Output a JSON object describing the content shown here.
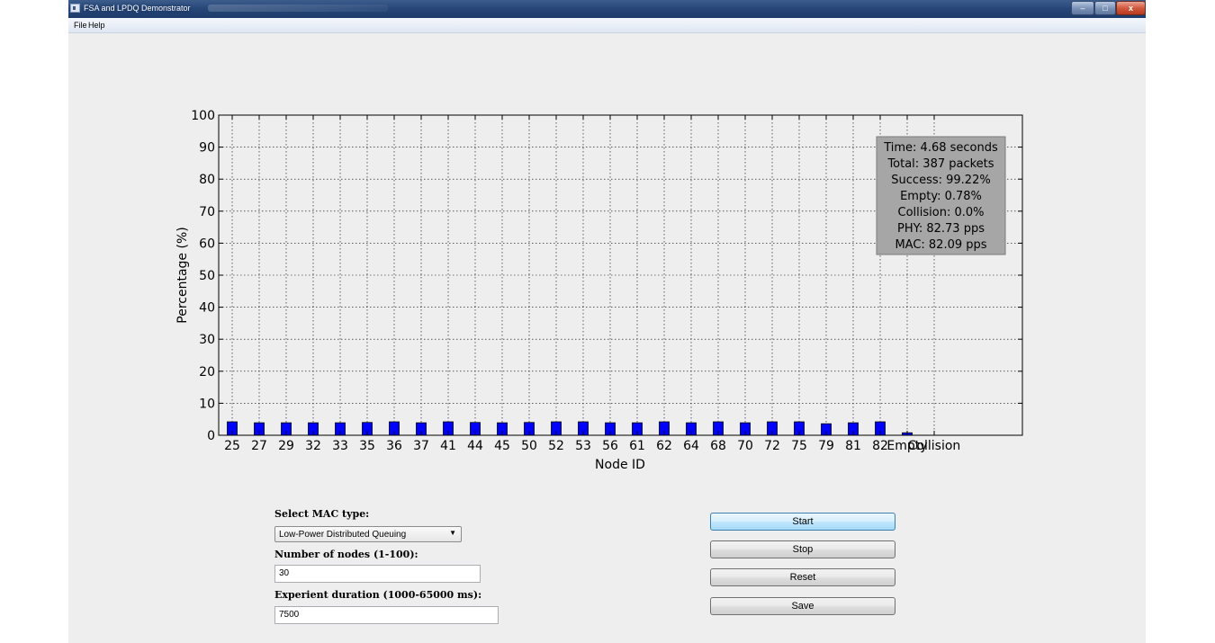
{
  "window": {
    "title": "FSA and LPDQ Demonstrator"
  },
  "controls": {
    "minimize": "–",
    "maximize": "□",
    "close": "x"
  },
  "menu": [
    "File",
    "Help"
  ],
  "chart_data": {
    "type": "bar",
    "xlabel": "Node ID",
    "ylabel": "Percentage (%)",
    "ylim": [
      0,
      100
    ],
    "yticks": [
      0,
      10,
      20,
      30,
      40,
      50,
      60,
      70,
      80,
      90,
      100
    ],
    "categories": [
      "25",
      "27",
      "29",
      "32",
      "33",
      "35",
      "36",
      "37",
      "41",
      "44",
      "45",
      "50",
      "52",
      "53",
      "56",
      "61",
      "62",
      "64",
      "68",
      "70",
      "72",
      "75",
      "79",
      "81",
      "82",
      "Empty",
      "Collision"
    ],
    "values": [
      4.2,
      3.9,
      3.9,
      3.9,
      3.9,
      4.0,
      4.2,
      3.9,
      4.2,
      4.0,
      3.9,
      4.0,
      4.2,
      4.2,
      3.9,
      3.9,
      4.2,
      3.9,
      4.2,
      3.9,
      4.2,
      4.2,
      3.6,
      3.9,
      4.2,
      0.78,
      0.0
    ],
    "grid": true,
    "bar_color": "#0000ff",
    "stats_box": [
      "Time: 4.68 seconds",
      "Total: 387 packets",
      "Success: 99.22%",
      "Empty: 0.78%",
      "Collision: 0.0%",
      "PHY: 82.73 pps",
      "MAC: 82.09 pps"
    ]
  },
  "form": {
    "mac_label": "Select MAC type:",
    "mac_value": "Low-Power Distributed Queuing",
    "nodes_label": "Number of nodes (1-100):",
    "nodes_value": "30",
    "duration_label": "Experient duration (1000-65000 ms):",
    "duration_value": "7500"
  },
  "buttons": {
    "start": "Start",
    "stop": "Stop",
    "reset": "Reset",
    "save": "Save"
  }
}
